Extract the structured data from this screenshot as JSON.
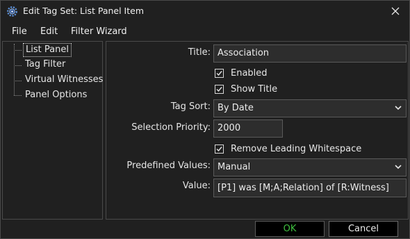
{
  "window": {
    "title": "Edit Tag Set: List Panel Item",
    "icon": "gear-app-icon",
    "close_icon": "close-icon"
  },
  "menu": [
    "File",
    "Edit",
    "Filter Wizard"
  ],
  "tree": {
    "items": [
      "List Panel",
      "Tag Filter",
      "Virtual Witnesses",
      "Panel Options"
    ],
    "selected": "List Panel"
  },
  "form": {
    "title_label": "Title:",
    "title_value": "Association",
    "enabled_label": "Enabled",
    "enabled_checked": true,
    "show_title_label": "Show Title",
    "show_title_checked": true,
    "tag_sort_label": "Tag Sort:",
    "tag_sort_value": "By Date",
    "selection_priority_label": "Selection Priority:",
    "selection_priority_value": "2000",
    "remove_ws_label": "Remove Leading Whitespace",
    "remove_ws_checked": true,
    "predefined_label": "Predefined Values:",
    "predefined_value": "Manual",
    "value_label": "Value:",
    "value_value": "[P1] was [M;A;Relation] of [R:Witness]"
  },
  "buttons": {
    "ok": "OK",
    "cancel": "Cancel"
  },
  "colors": {
    "ok_text": "#3fbf3f",
    "background": "#202020"
  }
}
